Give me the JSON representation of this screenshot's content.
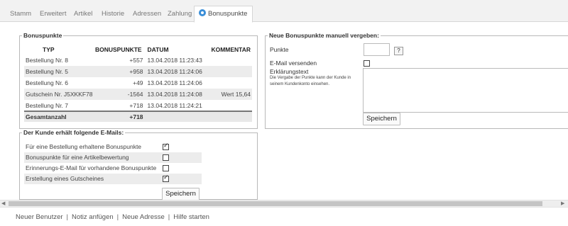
{
  "tabs": [
    {
      "label": "Stamm"
    },
    {
      "label": "Erweitert"
    },
    {
      "label": "Artikel"
    },
    {
      "label": "Historie"
    },
    {
      "label": "Adressen"
    },
    {
      "label": "Zahlung"
    },
    {
      "label": "Bonuspunkte",
      "active": true
    }
  ],
  "bonus": {
    "legend": "Bonuspunkte",
    "headers": {
      "typ": "TYP",
      "punkte": "BONUSPUNKTE",
      "datum": "DATUM",
      "kommentar": "KOMMENTAR"
    },
    "rows": [
      {
        "typ": "Bestellung Nr. 8",
        "punkte": "+557",
        "datum": "13.04.2018 11:23:43",
        "kommentar": ""
      },
      {
        "typ": "Bestellung Nr. 5",
        "punkte": "+958",
        "datum": "13.04.2018 11:24:06",
        "kommentar": ""
      },
      {
        "typ": "Bestellung Nr. 6",
        "punkte": "+49",
        "datum": "13.04.2018 11:24:06",
        "kommentar": ""
      },
      {
        "typ": "Gutschein Nr. J5XKKF78",
        "punkte": "-1564",
        "datum": "13.04.2018 11:24:08",
        "kommentar": "Wert 15,64"
      },
      {
        "typ": "Bestellung Nr. 7",
        "punkte": "+718",
        "datum": "13.04.2018 11:24:21",
        "kommentar": ""
      }
    ],
    "total_label": "Gesamtanzahl",
    "total_value": "+718"
  },
  "emails": {
    "legend": "Der Kunde erhält folgende E-Mails:",
    "items": [
      {
        "label": "Für eine Bestellung erhaltene Bonuspunkte",
        "checked": true
      },
      {
        "label": "Bonuspunkte für eine Artikelbewertung",
        "checked": false
      },
      {
        "label": "Erinnerungs-E-Mail für vorhandene Bonuspunkte",
        "checked": false
      },
      {
        "label": "Erstellung eines Gutscheines",
        "checked": true
      }
    ],
    "save_label": "Speichern"
  },
  "manual": {
    "legend": "Neue Bonuspunkte manuell vergeben:",
    "points_label": "Punkte",
    "points_value": "",
    "help_label": "?",
    "email_label": "E-Mail versenden",
    "email_checked": false,
    "reason_label": "Erklärungstext",
    "reason_hint": "Die Vergabe der Punkte kann der Kunde in seinem Kundenkonto einsehen.",
    "reason_value": "",
    "save_label": "Speichern"
  },
  "footer": {
    "links": [
      "Neuer Benutzer",
      "Notiz anfügen",
      "Neue Adresse",
      "Hilfe starten"
    ],
    "separator": "|"
  },
  "scrollbar": {
    "left_arrow": "◀",
    "right_arrow": "▶"
  }
}
